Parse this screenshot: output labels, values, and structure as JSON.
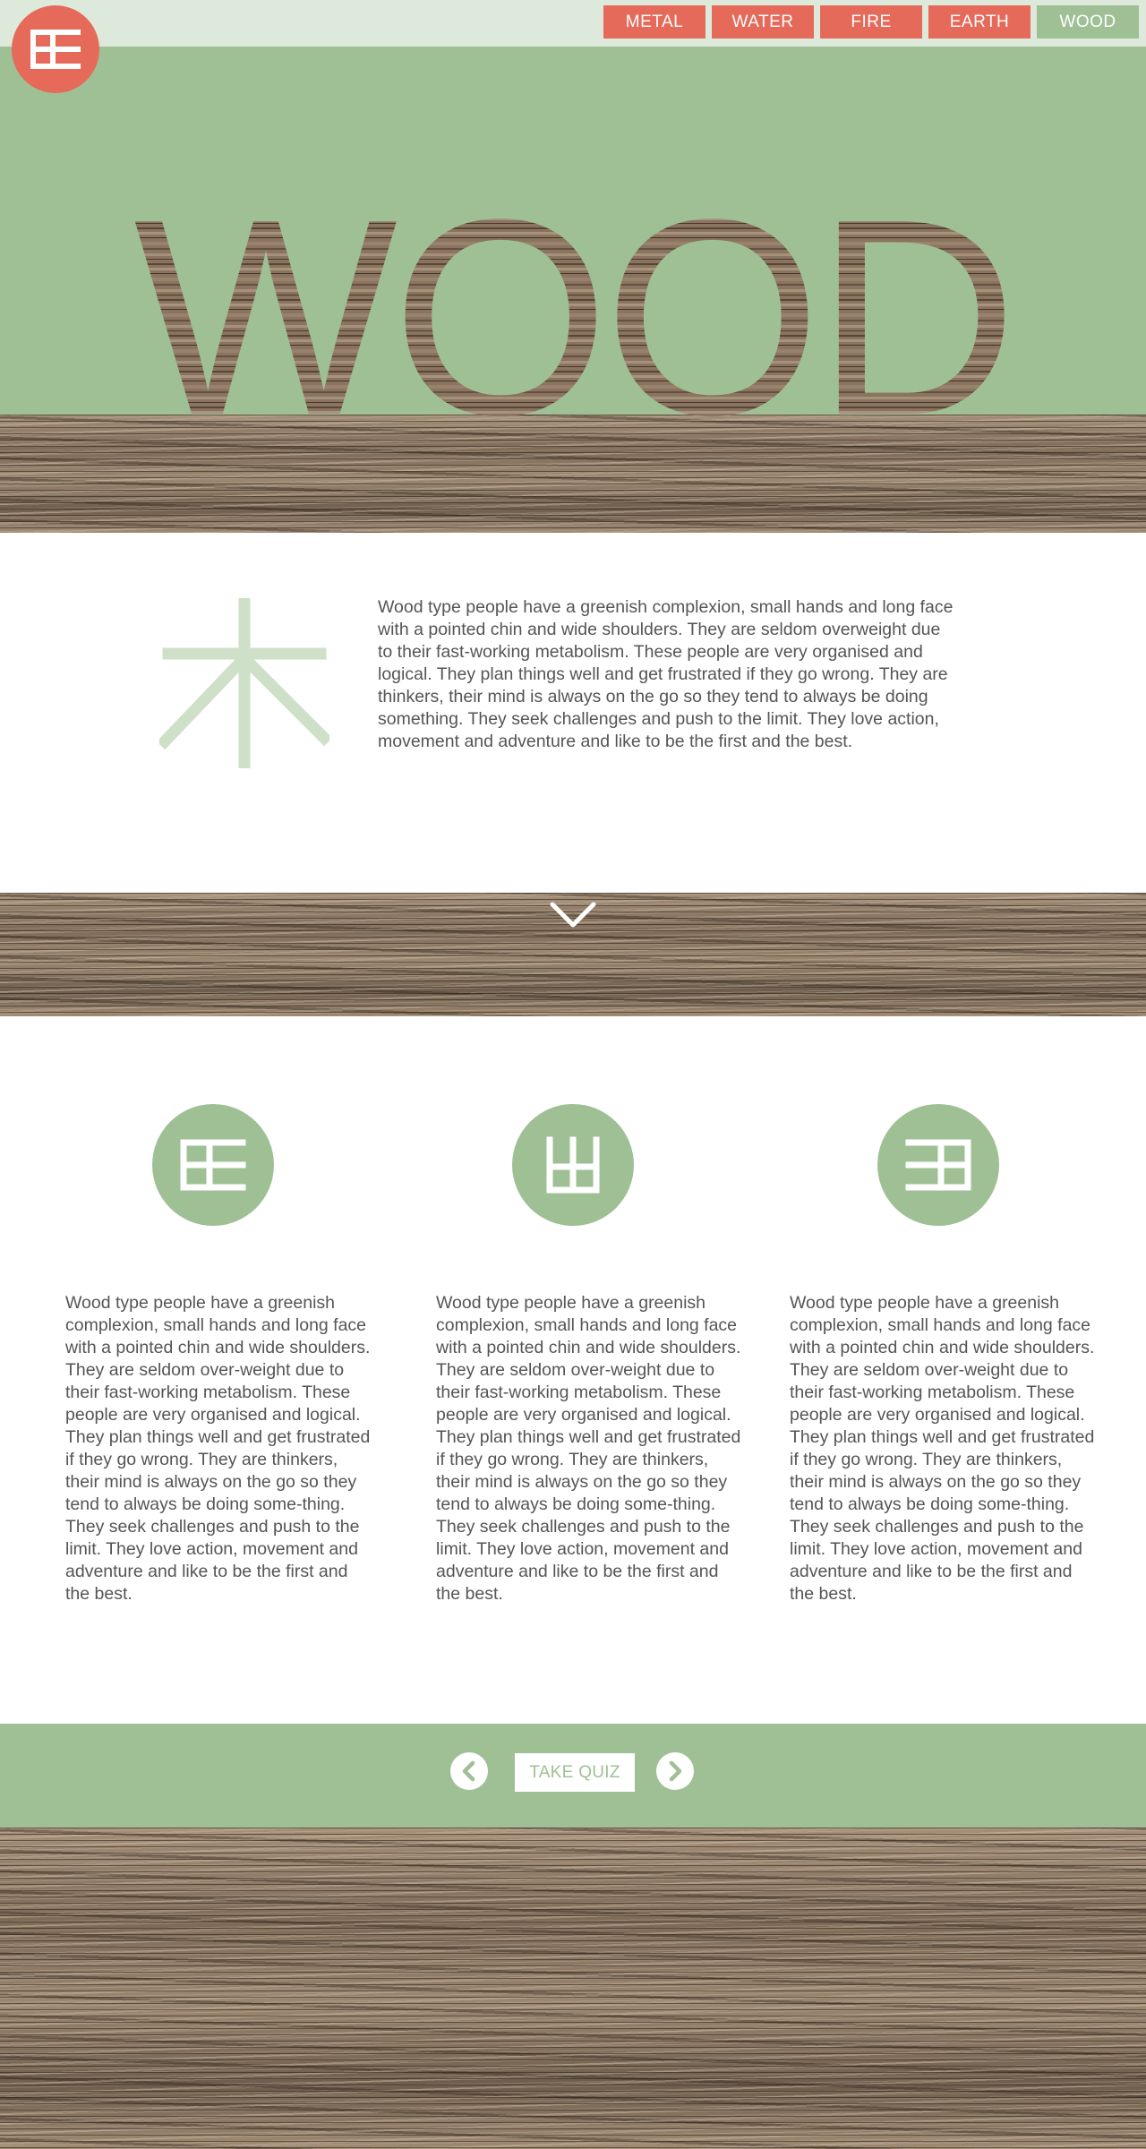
{
  "nav": {
    "items": [
      {
        "label": "METAL"
      },
      {
        "label": "WATER"
      },
      {
        "label": "FIRE"
      },
      {
        "label": "EARTH"
      },
      {
        "label": "WOOD",
        "active": true
      }
    ]
  },
  "hero": {
    "title": "WOOD"
  },
  "intro": {
    "glyph": "木",
    "paragraph": "Wood type people have a greenish complexion, small hands and long face with a pointed chin and wide shoulders. They are seldom overweight  due to their fast-working metabolism. These people are very organised and logical. They plan things well and get frustrated if they go wrong. They are thinkers, their mind is always on the go so they tend to always be doing something. They seek challenges and push to the limit. They love action, movement and adventure and like to be the first and the best."
  },
  "columns": [
    {
      "icon": "grid-glyph-icon",
      "text": "Wood type people have a greenish complexion, small hands and long face with a pointed chin and wide shoulders. They are seldom over-weight  due to their fast-working metabolism. These people are very organised and logical. They plan things well and get frustrated if they go wrong. They are thinkers, their mind is always on the go so they tend to always be doing some-thing. They seek challenges and push to the limit. They love action, movement and adventure and like to be the first and the best."
    },
    {
      "icon": "mountain-glyph-icon",
      "text": "Wood type people have a greenish complexion, small hands and long face with a pointed chin and wide shoulders. They are seldom over-weight  due to their fast-working metabolism. These people are very organised and logical. They plan things well and get frustrated if they go wrong. They are thinkers, their mind is always on the go so they tend to always be doing some-thing. They seek challenges and push to the limit. They love action, movement and adventure and like to be the first and the best."
    },
    {
      "icon": "jade-glyph-icon",
      "text": "Wood type people have a greenish complexion, small hands and long face with a pointed chin and wide shoulders. They are seldom over-weight  due to their fast-working metabolism. These people are very organised and logical. They plan things well and get frustrated if they go wrong. They are thinkers, their mind is always on the go so they tend to always be doing some-thing. They seek challenges and push to the limit. They love action, movement and adventure and like to be the first and the best."
    }
  ],
  "footer": {
    "quiz_label": "TAKE QUIZ",
    "prev_icon": "chevron-left-icon",
    "next_icon": "chevron-right-icon"
  },
  "colors": {
    "accent": "#e66a5a",
    "green": "#9fc095",
    "nav_bg": "#dde9da",
    "glyph_light": "#cfe0c9"
  }
}
